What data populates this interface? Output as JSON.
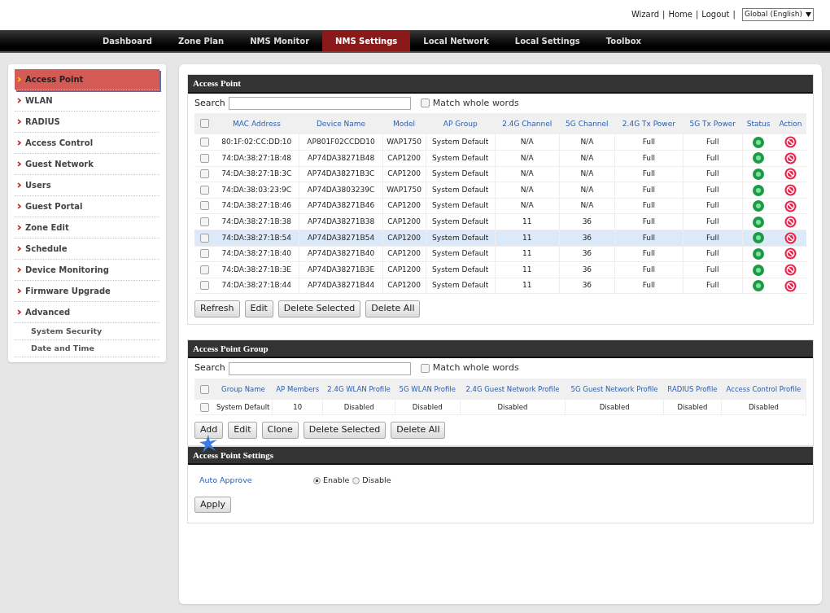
{
  "top_links": [
    {
      "label": "Wizard",
      "separator": "|"
    },
    {
      "label": "Home",
      "separator": "|"
    },
    {
      "label": "Logout",
      "separator": "|"
    }
  ],
  "language": {
    "value": "Global (English)"
  },
  "nav": [
    {
      "label": "Dashboard",
      "selected": false
    },
    {
      "label": "Zone Plan",
      "selected": false
    },
    {
      "label": "NMS Monitor",
      "selected": false
    },
    {
      "label": "NMS Settings",
      "selected": true
    },
    {
      "label": "Local Network",
      "selected": false
    },
    {
      "label": "Local Settings",
      "selected": false
    },
    {
      "label": "Toolbox",
      "selected": false
    }
  ],
  "sidebar": {
    "items": [
      {
        "label": "Access Point",
        "selected": true
      },
      {
        "label": "WLAN",
        "selected": false
      },
      {
        "label": "RADIUS",
        "selected": false
      },
      {
        "label": "Access Control",
        "selected": false
      },
      {
        "label": "Guest Network",
        "selected": false
      },
      {
        "label": "Users",
        "selected": false
      },
      {
        "label": "Guest Portal",
        "selected": false
      },
      {
        "label": "Zone Edit",
        "selected": false
      },
      {
        "label": "Schedule",
        "selected": false
      },
      {
        "label": "Device Monitoring",
        "selected": false
      },
      {
        "label": "Firmware Upgrade",
        "selected": false
      },
      {
        "label": "Advanced",
        "selected": false,
        "children": [
          {
            "label": "System Security",
            "selected": false
          },
          {
            "label": "Date and Time",
            "selected": false
          }
        ]
      }
    ]
  },
  "access_point": {
    "title": "Access Point",
    "search_label": "Search",
    "match_label": "Match whole words",
    "match_checked": false,
    "all_checked": false,
    "columns": [
      "MAC Address",
      "Device Name",
      "Model",
      "AP Group",
      "2.4G Channel",
      "5G Channel",
      "2.4G Tx Power",
      "5G Tx Power",
      "Status",
      "Action"
    ],
    "rows": [
      {
        "cells": [
          "80:1F:02:CC:DD:10",
          "AP801F02CCDD10",
          "WAP1750",
          "System Default",
          "N/A",
          "N/A",
          "Full",
          "Full"
        ],
        "online": true,
        "checked": false,
        "selected": false
      },
      {
        "cells": [
          "74:DA:38:27:1B:48",
          "AP74DA38271B48",
          "CAP1200",
          "System Default",
          "N/A",
          "N/A",
          "Full",
          "Full"
        ],
        "online": true,
        "checked": false,
        "selected": false
      },
      {
        "cells": [
          "74:DA:38:27:1B:3C",
          "AP74DA38271B3C",
          "CAP1200",
          "System Default",
          "N/A",
          "N/A",
          "Full",
          "Full"
        ],
        "online": true,
        "checked": false,
        "selected": false
      },
      {
        "cells": [
          "74:DA:38:03:23:9C",
          "AP74DA3803239C",
          "WAP1750",
          "System Default",
          "N/A",
          "N/A",
          "Full",
          "Full"
        ],
        "online": true,
        "checked": false,
        "selected": false
      },
      {
        "cells": [
          "74:DA:38:27:1B:46",
          "AP74DA38271B46",
          "CAP1200",
          "System Default",
          "N/A",
          "N/A",
          "Full",
          "Full"
        ],
        "online": true,
        "checked": false,
        "selected": false
      },
      {
        "cells": [
          "74:DA:38:27:1B:38",
          "AP74DA38271B38",
          "CAP1200",
          "System Default",
          "11",
          "36",
          "Full",
          "Full"
        ],
        "online": true,
        "checked": false,
        "selected": false
      },
      {
        "cells": [
          "74:DA:38:27:1B:54",
          "AP74DA38271B54",
          "CAP1200",
          "System Default",
          "11",
          "36",
          "Full",
          "Full"
        ],
        "online": true,
        "checked": false,
        "selected": true
      },
      {
        "cells": [
          "74:DA:38:27:1B:40",
          "AP74DA38271B40",
          "CAP1200",
          "System Default",
          "11",
          "36",
          "Full",
          "Full"
        ],
        "online": true,
        "checked": false,
        "selected": false
      },
      {
        "cells": [
          "74:DA:38:27:1B:3E",
          "AP74DA38271B3E",
          "CAP1200",
          "System Default",
          "11",
          "36",
          "Full",
          "Full"
        ],
        "online": true,
        "checked": false,
        "selected": false
      },
      {
        "cells": [
          "74:DA:38:27:1B:44",
          "AP74DA38271B44",
          "CAP1200",
          "System Default",
          "11",
          "36",
          "Full",
          "Full"
        ],
        "online": true,
        "checked": false,
        "selected": false
      }
    ],
    "buttons": [
      "Refresh",
      "Edit",
      "Delete Selected",
      "Delete All"
    ]
  },
  "access_point_group": {
    "title": "Access Point Group",
    "search_label": "Search",
    "match_label": "Match whole words",
    "match_checked": false,
    "all_checked": false,
    "columns": [
      "Group Name",
      "AP Members",
      "2.4G WLAN Profile",
      "5G WLAN Profile",
      "2.4G Guest Network Profile",
      "5G Guest Network Profile",
      "RADIUS Profile",
      "Access Control Profile"
    ],
    "rows": [
      {
        "cells": [
          "System Default",
          "10",
          "Disabled",
          "Disabled",
          "Disabled",
          "Disabled",
          "Disabled",
          "Disabled"
        ],
        "checked": false
      }
    ],
    "buttons": [
      "Add",
      "Edit",
      "Clone",
      "Delete Selected",
      "Delete All"
    ]
  },
  "access_point_settings": {
    "title": "Access Point Settings",
    "auto_approve": {
      "label": "Auto Approve",
      "options": [
        {
          "label": "Enable",
          "selected": true
        },
        {
          "label": "Disable",
          "selected": false
        }
      ]
    },
    "buttons": [
      "Apply"
    ]
  }
}
